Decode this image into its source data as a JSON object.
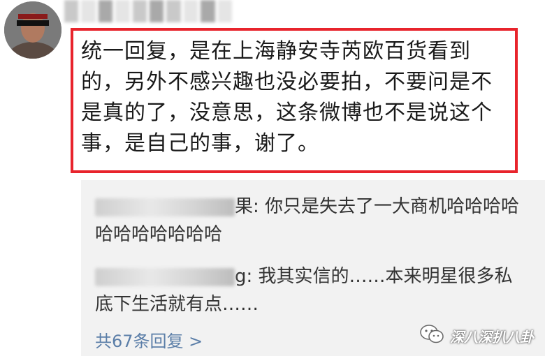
{
  "main_post": {
    "text": "统一回复，是在上海静安寺芮欧百货看到的，另外不感兴趣也没必要拍，不要问是不是真的了，没意思，这条微博也不是说这个事，是自己的事，谢了。"
  },
  "replies": [
    {
      "user_suffix": "果: ",
      "text": "你只是失去了一大商机哈哈哈哈哈哈哈哈哈哈哈"
    },
    {
      "user_suffix": "g: ",
      "text": "我其实信的……本来明星很多私底下生活就有点……"
    }
  ],
  "more_replies_label": "共67条回复 >",
  "watermark": {
    "text": "深八深扒八卦",
    "icon": "wechat-icon"
  },
  "colors": {
    "highlight": "#e8242c",
    "link": "#5b7ea8",
    "reply_bg": "#f2f2f2"
  }
}
